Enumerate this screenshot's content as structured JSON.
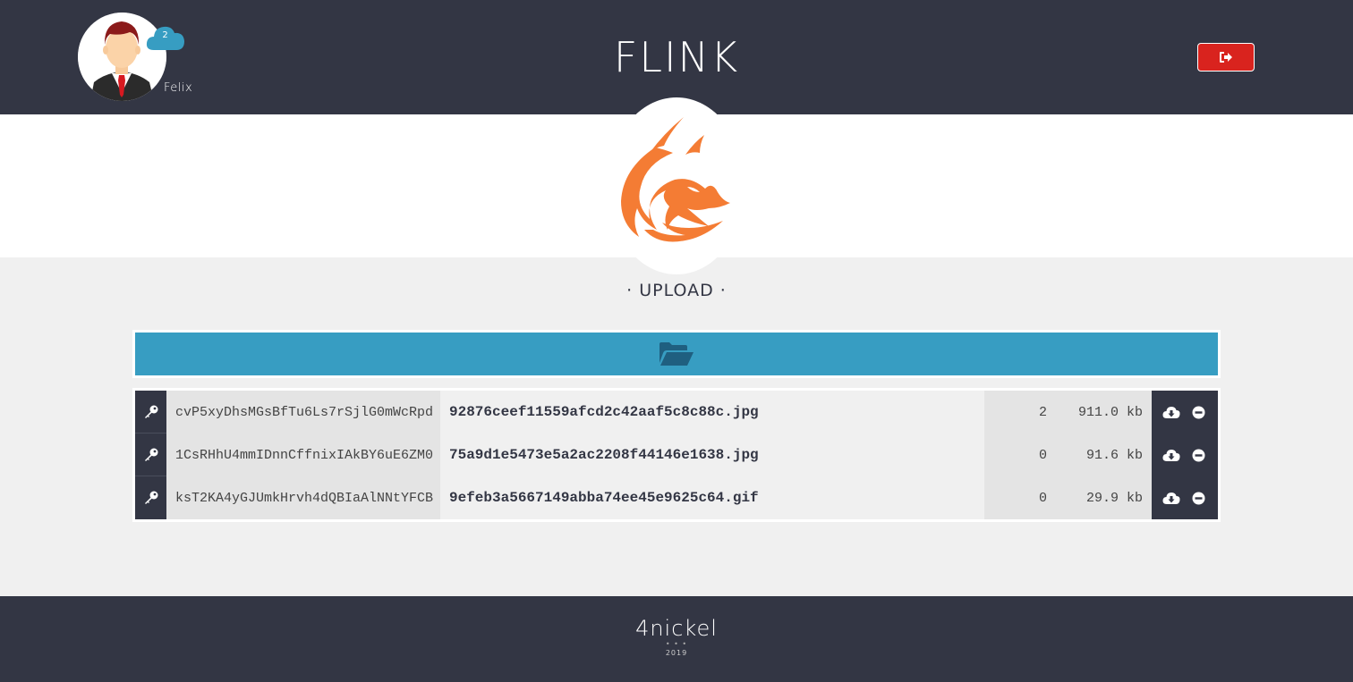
{
  "header": {
    "title": "FLINK",
    "username": "Felix",
    "notification_count": "2",
    "logout_icon": "sign-out-icon"
  },
  "main": {
    "section_title": "· UPLOAD ·",
    "upload_icon": "folder-open-icon"
  },
  "files": [
    {
      "token": "cvP5xyDhsMGsBfTu6Ls7rSjlG0mWcRpd",
      "name": "92876ceef11559afcd2c42aaf5c8c88c.jpg",
      "count": "2",
      "size": "911.0 kb"
    },
    {
      "token": "1CsRHhU4mmIDnnCffnixIAkBY6uE6ZM0",
      "name": "75a9d1e5473e5a2ac2208f44146e1638.jpg",
      "count": "0",
      "size": "91.6 kb"
    },
    {
      "token": "ksT2KA4yGJUmkHrvh4dQBIaAlNNtYFCB",
      "name": "9efeb3a5667149abba74ee45e9625c64.gif",
      "count": "0",
      "size": "29.9 kb"
    }
  ],
  "footer": {
    "brand": "4nickel",
    "dots": "• • •",
    "year": "2019"
  },
  "colors": {
    "header_bg": "#333644",
    "accent_blue": "#379dc2",
    "logout_red": "#d9231e",
    "fox_orange": "#f47c34"
  }
}
